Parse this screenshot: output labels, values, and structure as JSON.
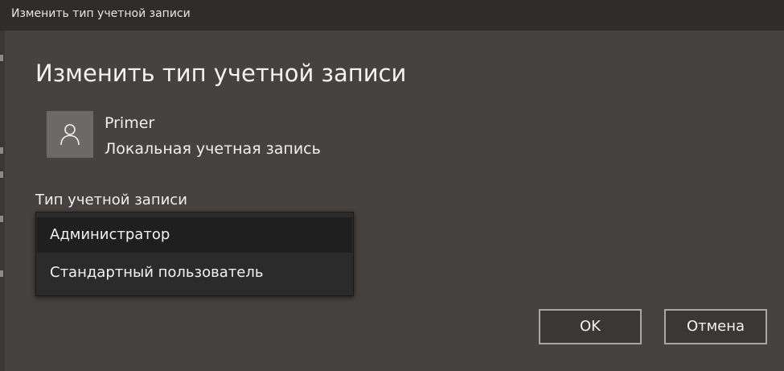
{
  "window": {
    "title": "Изменить тип учетной записи"
  },
  "dialog": {
    "heading": "Изменить тип учетной записи",
    "user": {
      "avatar_icon": "user-icon",
      "name": "Primer",
      "account_kind": "Локальная учетная запись"
    },
    "account_type": {
      "label": "Тип учетной записи",
      "selected": "Администратор",
      "options": [
        "Администратор",
        "Стандартный пользователь"
      ]
    },
    "buttons": {
      "ok_label": "OK",
      "cancel_label": "Отмена"
    }
  },
  "colors": {
    "dialog_background": "#454240",
    "titlebar_background": "#2f2d2c",
    "dropdown_background": "#2b2b2b",
    "button_border": "#a8a8a8"
  }
}
